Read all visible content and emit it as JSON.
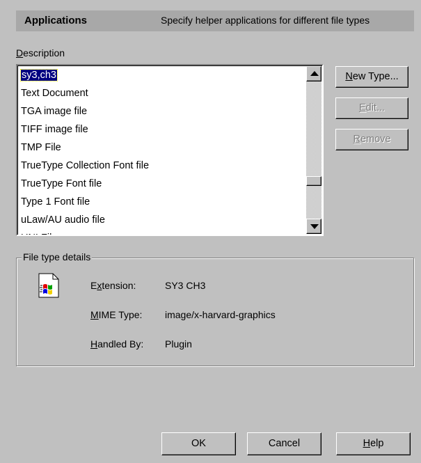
{
  "header": {
    "title": "Applications",
    "description": "Specify helper applications for different file types"
  },
  "list": {
    "label_mnemonic": "D",
    "label_rest": "escription",
    "items": [
      "sy3,ch3",
      "Text Document",
      "TGA image file",
      "TIFF image file",
      "TMP File",
      "TrueType Collection Font file",
      "TrueType Font file",
      "Type 1 Font file",
      "uLaw/AU audio file",
      "UNLFile"
    ],
    "selected_index": 0
  },
  "side_buttons": {
    "new_type": {
      "mnemonic": "N",
      "rest": "ew Type..."
    },
    "edit": {
      "mnemonic": "E",
      "rest": "dit..."
    },
    "remove": {
      "mnemonic": "R",
      "rest": "emove"
    }
  },
  "details": {
    "legend": "File type details",
    "extension": {
      "label_pre": "E",
      "label_mn": "x",
      "label_post": "tension:",
      "value": "SY3 CH3"
    },
    "mime": {
      "label_mn": "M",
      "label_post": "IME Type:",
      "value": "image/x-harvard-graphics"
    },
    "handled_by": {
      "label_mn": "H",
      "label_post": "andled By:",
      "value": "Plugin"
    }
  },
  "footer": {
    "ok": "OK",
    "cancel": "Cancel",
    "help_mnemonic": "H",
    "help_rest": "elp"
  }
}
